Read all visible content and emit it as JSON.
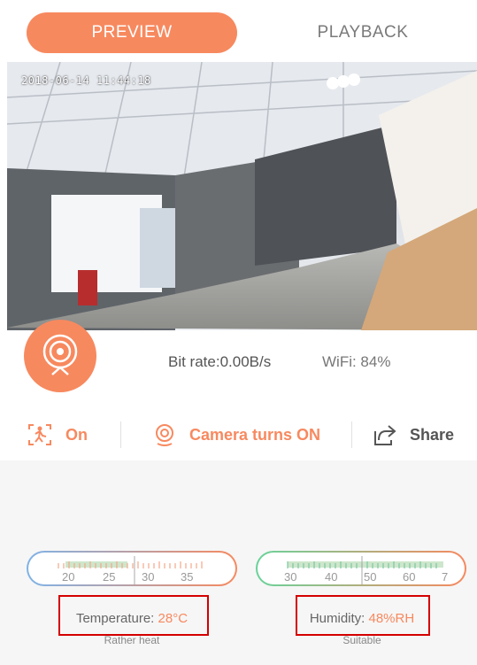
{
  "tabs": [
    {
      "label": "PREVIEW"
    },
    {
      "label": "PLAYBACK"
    }
  ],
  "video": {
    "timestamp": "2018-06-14 11:44:18"
  },
  "status": {
    "bitrate": "Bit rate:0.00B/s",
    "wifi": "WiFi: 84%"
  },
  "actions": {
    "motion": "On",
    "camera": "Camera turns ON",
    "share": "Share"
  },
  "temperature": {
    "label": "Temperature:",
    "value": "28°C",
    "note": "Rather heat",
    "scale": [
      "20",
      "25",
      "30",
      "35"
    ]
  },
  "humidity": {
    "label": "Humidity:",
    "value": "48%RH",
    "note": "Suitable",
    "scale": [
      "30",
      "40",
      "50",
      "60",
      "7"
    ]
  },
  "colors": {
    "accent": "#f7895f",
    "temp_grad_start": "#7fb3e8",
    "hum_grad_start": "#69d39a",
    "box": "#d40000"
  }
}
